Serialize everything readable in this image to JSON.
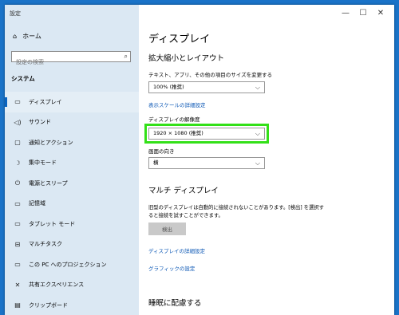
{
  "window": {
    "title": "設定",
    "minimize": "—",
    "maximize": "☐",
    "close": "✕"
  },
  "sidebar": {
    "home": {
      "icon": "⌂",
      "label": "ホーム"
    },
    "search_placeholder": "設定の検索",
    "search_icon": "⌕",
    "system_label": "システム",
    "items": [
      {
        "icon": "▭",
        "label": "ディスプレイ",
        "active": true
      },
      {
        "icon": "◁)",
        "label": "サウンド"
      },
      {
        "icon": "▢",
        "label": "通知とアクション"
      },
      {
        "icon": "☽",
        "label": "集中モード"
      },
      {
        "icon": "⏻",
        "label": "電源とスリープ"
      },
      {
        "icon": "▭",
        "label": "記憶域"
      },
      {
        "icon": "▭",
        "label": "タブレット モード"
      },
      {
        "icon": "⊟",
        "label": "マルチタスク"
      },
      {
        "icon": "▭",
        "label": "この PC へのプロジェクション"
      },
      {
        "icon": "✕",
        "label": "共有エクスペリエンス"
      },
      {
        "icon": "▤",
        "label": "クリップボード"
      }
    ]
  },
  "main": {
    "title": "ディスプレイ",
    "scale_section": "拡大縮小とレイアウト",
    "text_size_label": "テキスト、アプリ、その他の項目のサイズを変更する",
    "text_size_value": "100% (推奨)",
    "advanced_scale_link": "表示スケールの詳細設定",
    "resolution_label": "ディスプレイの解像度",
    "resolution_value": "1920 × 1080 (推奨)",
    "orientation_label": "画面の向き",
    "orientation_value": "横",
    "multi_section": "マルチ ディスプレイ",
    "multi_desc": "旧型のディスプレイは自動的に接続されないことがあります。[検出] を選択すると接続を試すことができます。",
    "detect_button": "検出",
    "advanced_display_link": "ディスプレイの詳細設定",
    "graphics_link": "グラフィックの設定",
    "sleep_section": "睡眠に配慮する",
    "chevron": "⌵"
  },
  "colors": {
    "accent": "#0b57b5",
    "highlight": "#33e018",
    "sidebar_bg": "#dbe8f3",
    "desktop_bg": "#1a73c8"
  }
}
